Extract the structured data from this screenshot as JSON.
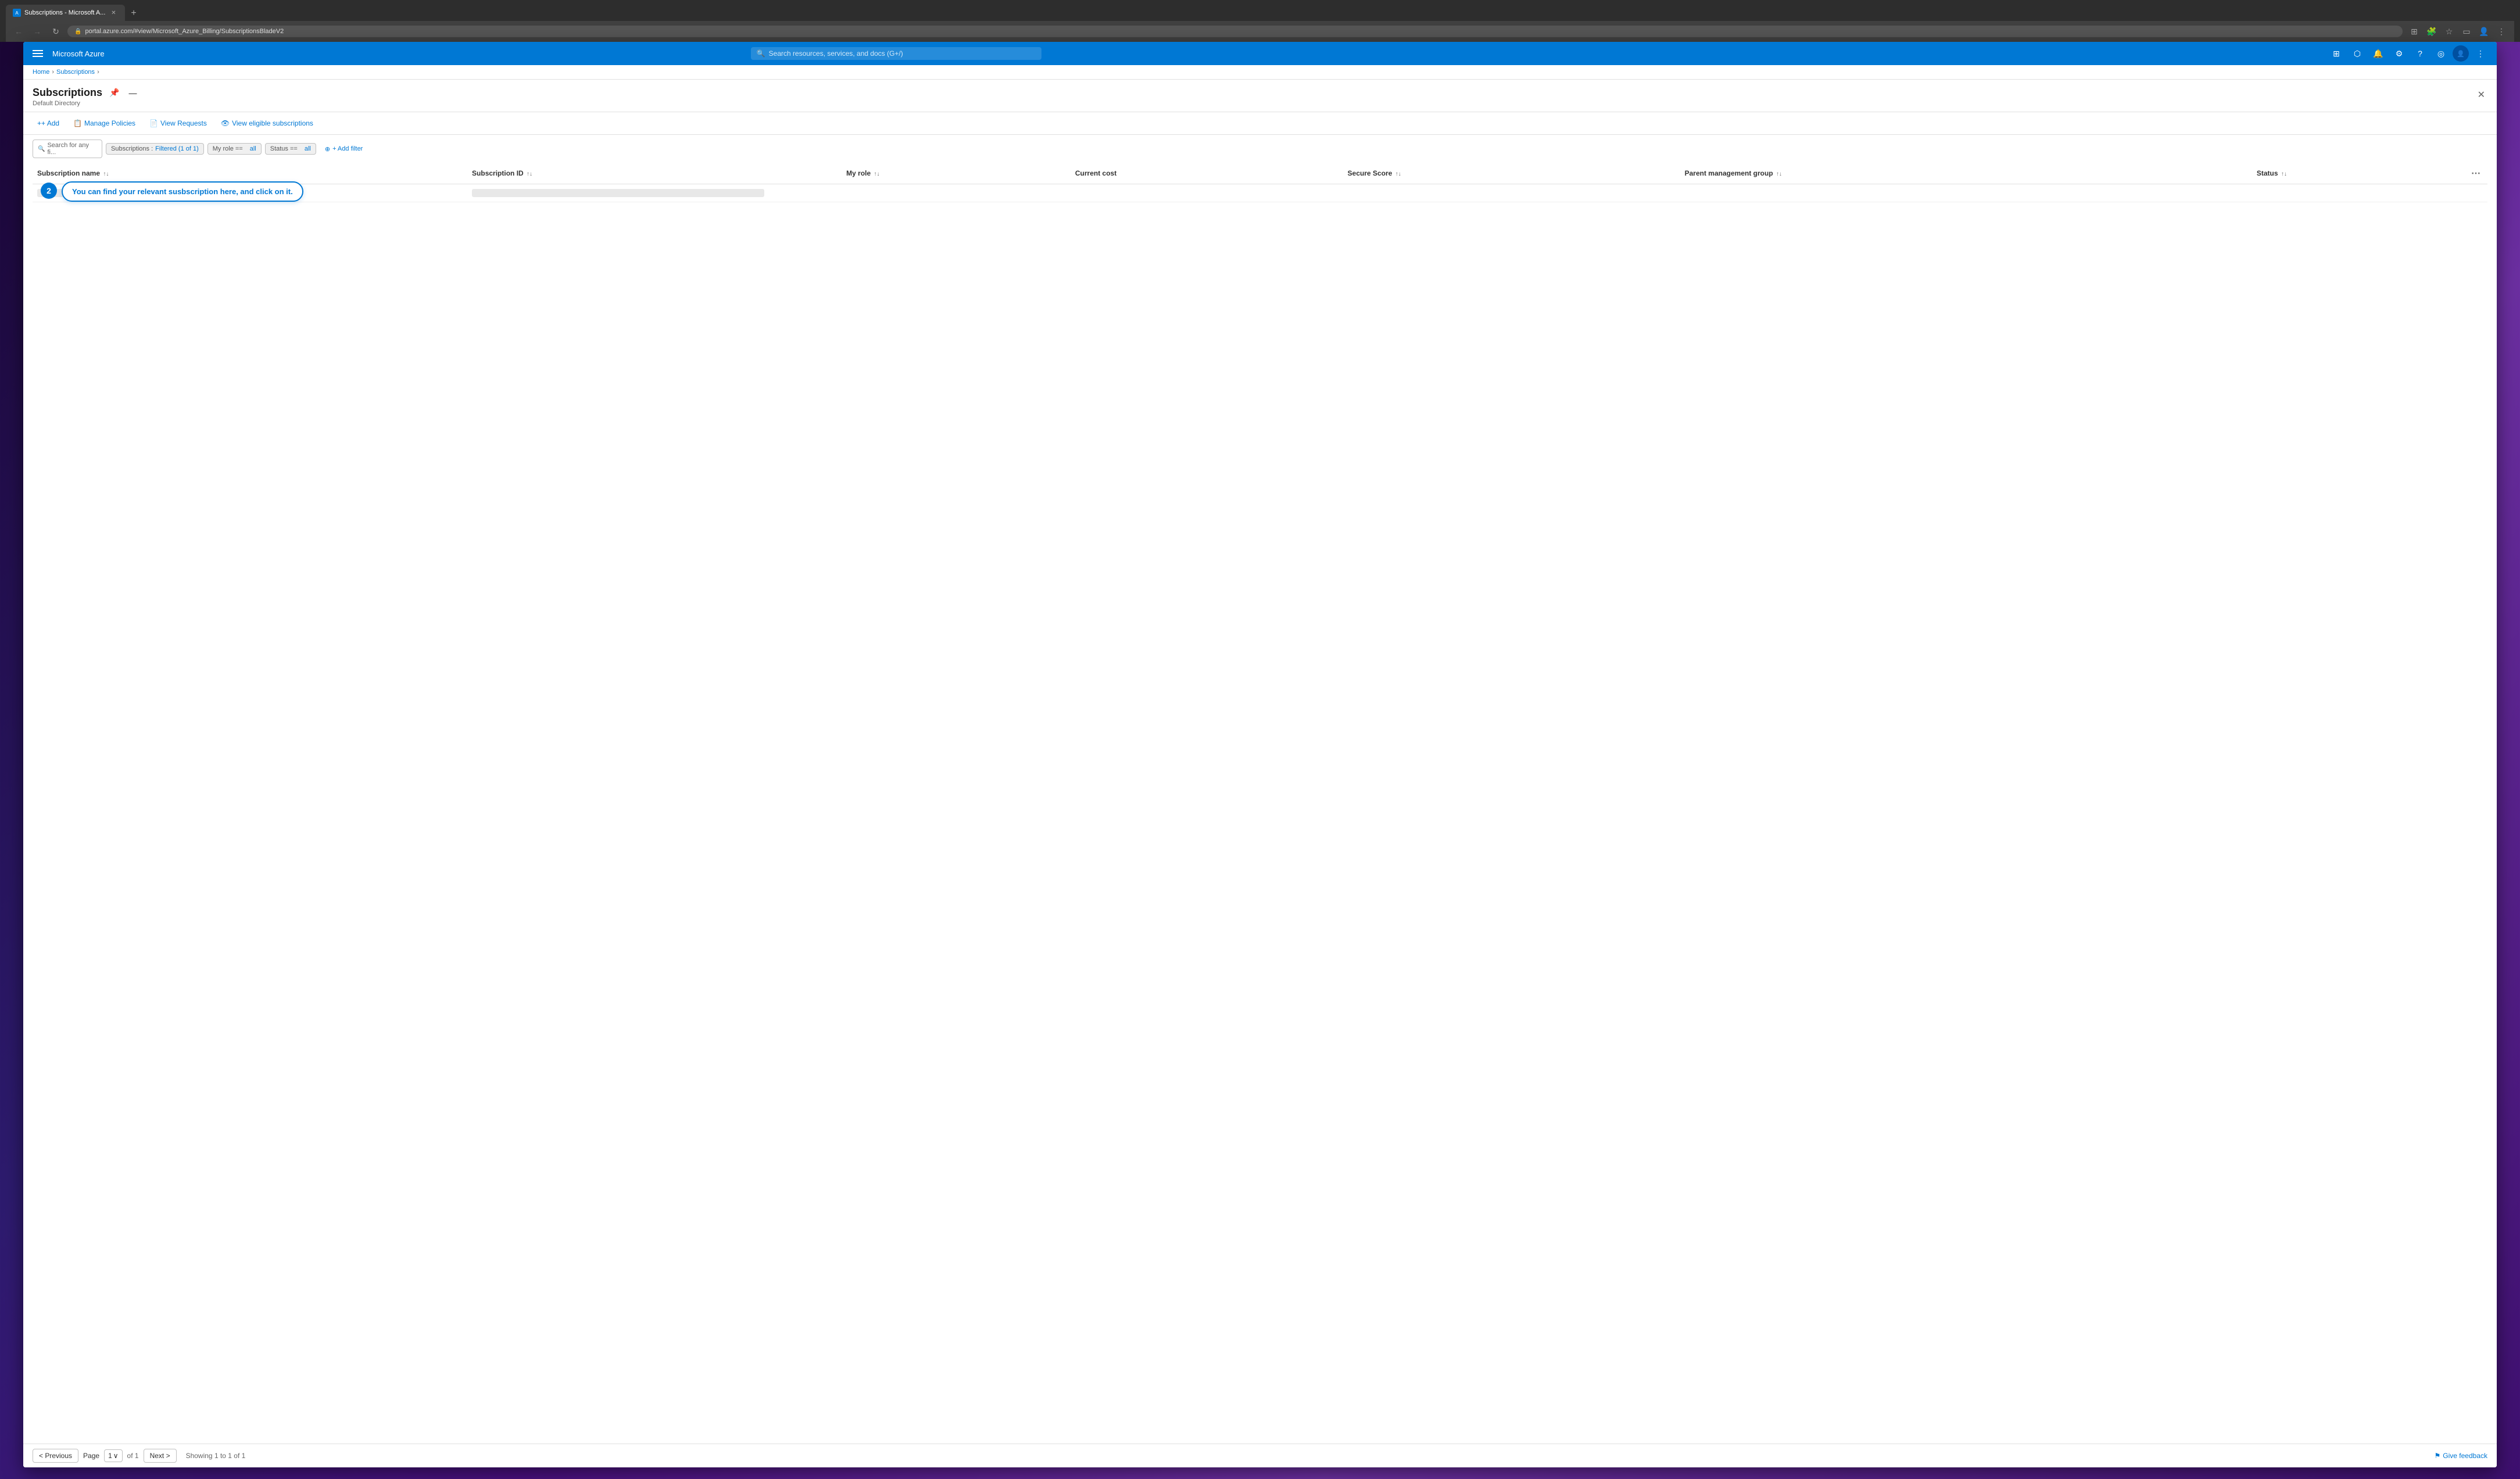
{
  "browser": {
    "tab_label": "Subscriptions - Microsoft A...",
    "tab_favicon": "A",
    "address": "portal.azure.com/#view/Microsoft_Azure_Billing/SubscriptionsBladeV2",
    "lock_icon": "🔒",
    "add_tab_label": "+",
    "nav_back_disabled": true,
    "nav_forward_disabled": true,
    "nav_refresh": "↻"
  },
  "topbar": {
    "logo": "Microsoft Azure",
    "search_placeholder": "Search resources, services, and docs (G+/)",
    "icons": [
      "⊞",
      "⬡",
      "🔔",
      "⚙",
      "?",
      "◎",
      "👤",
      "⋮"
    ]
  },
  "breadcrumb": {
    "home": "Home",
    "subscriptions": "Subscriptions"
  },
  "page": {
    "title": "Subscriptions",
    "subtitle": "Default Directory",
    "pin_icon": "📌",
    "minimize_icon": "—",
    "close_icon": "✕"
  },
  "toolbar": {
    "add_label": "+ Add",
    "manage_policies_label": "Manage Policies",
    "view_requests_label": "View Requests",
    "view_eligible_label": "View eligible subscriptions",
    "manage_icon": "📋",
    "view_icon": "📄",
    "eligible_icon": "👁"
  },
  "filter_bar": {
    "search_placeholder": "Search for any fi...",
    "filter_chip_subscriptions_label": "Subscriptions :",
    "filter_chip_subscriptions_value": "Filtered (1 of 1)",
    "filter_chip_myrole_label": "My role ==",
    "filter_chip_myrole_value": "all",
    "filter_chip_status_label": "Status ==",
    "filter_chip_status_value": "all",
    "add_filter_label": "+ Add filter"
  },
  "table": {
    "columns": [
      {
        "id": "subscription_name",
        "label": "Subscription name",
        "sort": "↑↓"
      },
      {
        "id": "subscription_id",
        "label": "Subscription ID",
        "sort": "↑↓"
      },
      {
        "id": "my_role",
        "label": "My role",
        "sort": "↑↓"
      },
      {
        "id": "current_cost",
        "label": "Current cost",
        "sort": ""
      },
      {
        "id": "secure_score",
        "label": "Secure Score",
        "sort": "↑↓"
      },
      {
        "id": "parent_mgmt_group",
        "label": "Parent management group",
        "sort": "↑↓"
      },
      {
        "id": "status",
        "label": "Status",
        "sort": "↑↓"
      }
    ],
    "rows": [
      {
        "subscription_name": "",
        "subscription_id": "",
        "my_role": "",
        "current_cost": "",
        "secure_score": "",
        "parent_mgmt_group": "",
        "status": ""
      }
    ]
  },
  "callout": {
    "badge": "2",
    "message": "You can find your relevant susbscription here, and click on it."
  },
  "bottom_bar": {
    "previous_label": "< Previous",
    "next_label": "Next >",
    "page_label": "Page",
    "page_value": "1",
    "page_dropdown_icon": "∨",
    "of_label": "of 1",
    "showing_label": "Showing 1 to 1 of 1",
    "feedback_icon": "⚑",
    "feedback_label": "Give feedback"
  }
}
